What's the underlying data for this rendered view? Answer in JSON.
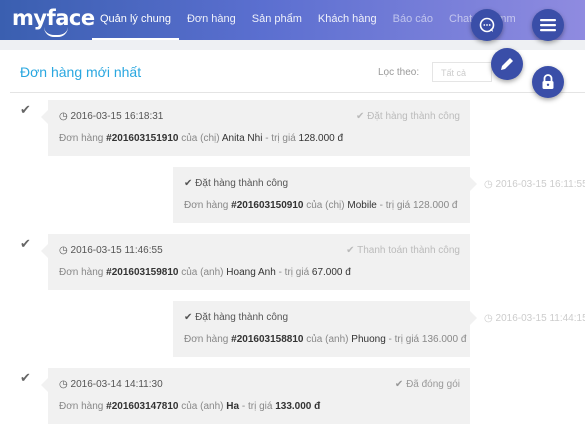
{
  "app": {
    "logo": "myface"
  },
  "nav": {
    "items": [
      {
        "label": "Quản lý chung"
      },
      {
        "label": "Đơn hàng"
      },
      {
        "label": "Sản phẩm"
      },
      {
        "label": "Khách hàng"
      },
      {
        "label": "Báo cáo"
      },
      {
        "label": "Chat & comm"
      }
    ]
  },
  "panel": {
    "title": "Đơn hàng mới nhất",
    "filter_label": "Lọc theo:",
    "filter_value": "Tất cả"
  },
  "orders": [
    {
      "time": "2016-03-15 16:18:31",
      "status": "Đặt hàng thành công",
      "prefix": "Đơn hàng",
      "id": "#201603151910",
      "rel": "của (chị)",
      "name": "Anita Nhi",
      "value_label": "- trị giá",
      "value": "128.000 đ"
    },
    {
      "time": "2016-03-15 16:11:55",
      "status": "Đặt hàng thành công",
      "prefix": "Đơn hàng",
      "id": "#201603150910",
      "rel": "của (chị)",
      "name": "Mobile",
      "value_label": "- trị giá",
      "value": "128.000 đ"
    },
    {
      "time": "2016-03-15 11:46:55",
      "status": "Thanh toán thành công",
      "prefix": "Đơn hàng",
      "id": "#201603159810",
      "rel": "của (anh)",
      "name": "Hoang Anh",
      "value_label": "- trị giá",
      "value": "67.000 đ"
    },
    {
      "time": "2016-03-15 11:44:15",
      "status": "Đặt hàng thành công",
      "prefix": "Đơn hàng",
      "id": "#201603158810",
      "rel": "của (anh)",
      "name": "Phuong",
      "value_label": "- trị giá",
      "value": "136.000 đ"
    },
    {
      "time": "2016-03-14 14:11:30",
      "status": "Đã đóng gói",
      "prefix": "Đơn hàng",
      "id": "#201603147810",
      "rel": "của (anh)",
      "name": "Ha",
      "value_label": "- trị giá",
      "value": "133.000 đ"
    }
  ],
  "fabs": [
    {
      "icon": "chat-icon"
    },
    {
      "icon": "menu-icon"
    },
    {
      "icon": "pencil-icon"
    },
    {
      "icon": "lock-icon"
    }
  ]
}
